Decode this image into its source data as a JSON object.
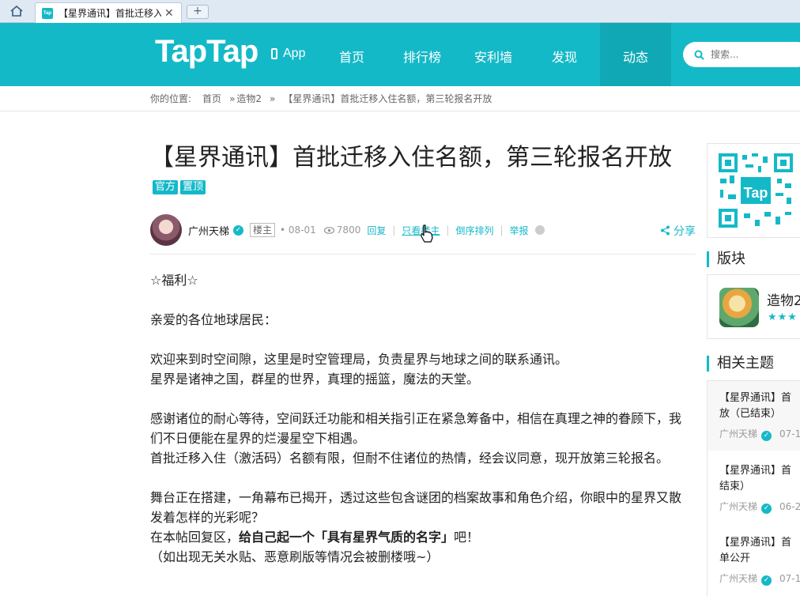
{
  "browser": {
    "tab_title": "【星界通讯】首批迁移入",
    "favicon_text": "Tap",
    "close_glyph": "✕",
    "new_tab_glyph": "+"
  },
  "nav": {
    "logo": "TapTap",
    "app_label": "App",
    "items": [
      "首页",
      "排行榜",
      "安利墙",
      "发现",
      "动态"
    ],
    "active_index": 4,
    "search_placeholder": "搜索...",
    "brand_color": "#14b9c8"
  },
  "breadcrumb": {
    "prefix": "你的位置:",
    "items": [
      "首页",
      "造物2",
      "【星界通讯】首批迁移入住名额，第三轮报名开放"
    ],
    "separator": "»"
  },
  "post": {
    "title": "【星界通讯】首批迁移入住名额，第三轮报名开放",
    "tags": [
      "官方",
      "置顶"
    ],
    "author": "广州天梯",
    "role_badge": "楼主",
    "date": "• 08-01",
    "views": "7800",
    "actions": [
      "回复",
      "只看楼主",
      "倒序排列",
      "举报"
    ],
    "share_label": "分享",
    "body": {
      "p1": "☆福利☆",
      "p2": "亲爱的各位地球居民：",
      "p3a": "欢迎来到时空间隙，这里是时空管理局，负责星界与地球之间的联系通讯。",
      "p3b": "星界是诸神之国，群星的世界，真理的摇篮，魔法的天堂。",
      "p4a": "感谢诸位的耐心等待，空间跃迁功能和相关指引正在紧急筹备中，相信在真理之神的眷顾下，我们不日便能在星界的烂漫星空下相遇。",
      "p4b": "首批迁移入住（激活码）名额有限，但耐不住诸位的热情，经会议同意，现开放第三轮报名。",
      "p5a": "舞台正在搭建，一角幕布已揭开，透过这些包含谜团的档案故事和角色介绍，你眼中的星界又散发着怎样的光彩呢？",
      "p5b_pre": "在本帖回复区，",
      "p5b_bold": "给自己起一个「具有星界气质的名字」",
      "p5b_post": "吧！",
      "p5c": "（如出现无关水贴、恶意刷版等情况会被删楼哦~）"
    }
  },
  "sidebar": {
    "board_heading": "版块",
    "board_name": "造物2",
    "board_stars": "★★★",
    "related_heading": "相关主题",
    "related": [
      {
        "title_line1": "【星界通讯】首",
        "title_line2": "放（已结束）",
        "author": "广州天梯",
        "date": "07-1"
      },
      {
        "title_line1": "【星界通讯】首",
        "title_line2": "结束）",
        "author": "广州天梯",
        "date": "06-2"
      },
      {
        "title_line1": "【星界通讯】首",
        "title_line2": "单公开",
        "author": "广州天梯",
        "date": "07-1"
      }
    ]
  }
}
